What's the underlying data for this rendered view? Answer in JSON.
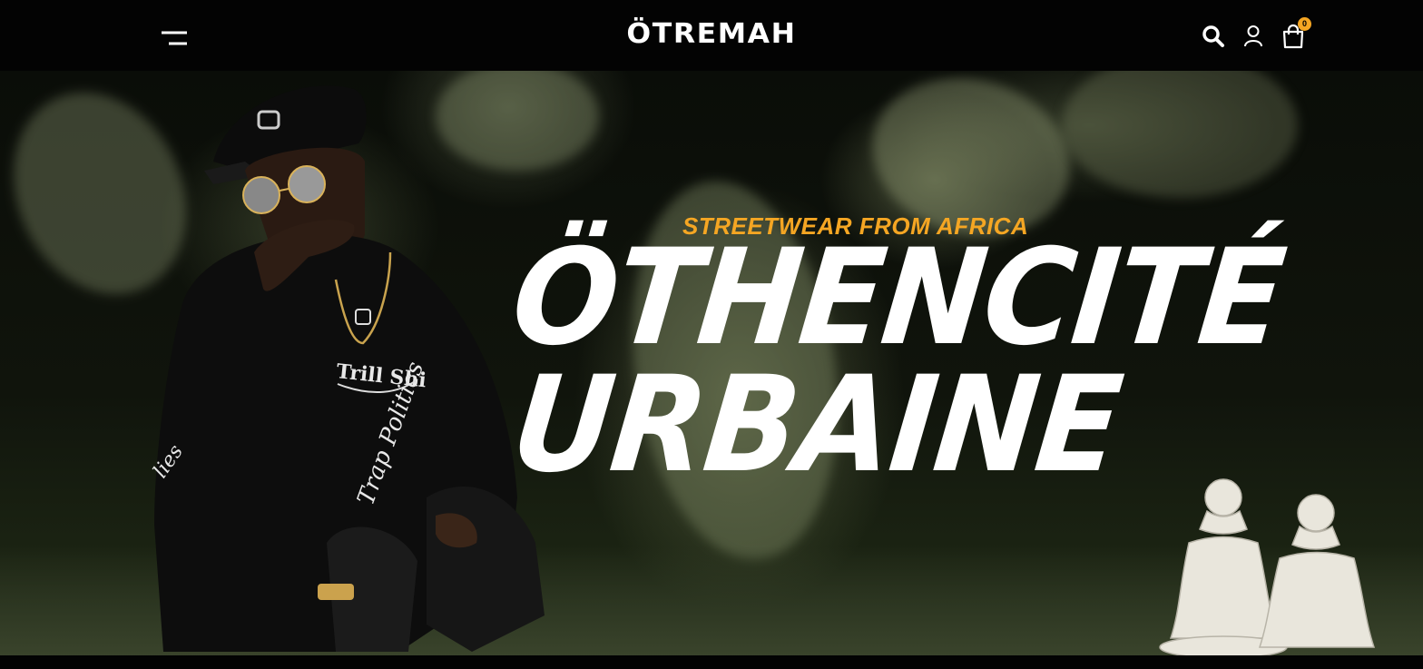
{
  "header": {
    "brand": "ÖTREMAH",
    "menu_icon": "hamburger-menu-icon",
    "search_icon": "search-icon",
    "account_icon": "user-account-icon",
    "cart_icon": "shopping-bag-icon",
    "cart_count": "0"
  },
  "hero": {
    "tagline": "STREETWEAR FROM AFRICA",
    "headline_line1": "ÖTHENCITÉ",
    "headline_line2": "URBAINE",
    "image_subject": "man in black cap and sunglasses crouching among leaves with chess pawns"
  },
  "colors": {
    "accent": "#f5a623",
    "header_bg": "#030303",
    "headline": "#ffffff"
  }
}
